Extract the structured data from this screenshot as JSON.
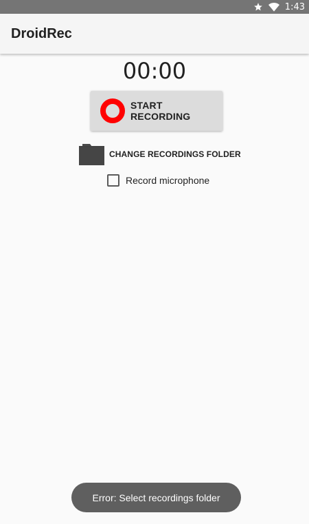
{
  "status_bar": {
    "time": "1:43",
    "icons": [
      "star-icon",
      "wifi-icon"
    ]
  },
  "app_bar": {
    "title": "DroidRec"
  },
  "timer": {
    "value": "00:00"
  },
  "record_button": {
    "label": "START RECORDING",
    "icon": "record-icon",
    "icon_color": "#ff0000"
  },
  "folder_button": {
    "label": "CHANGE RECORDINGS FOLDER",
    "icon": "folder-icon"
  },
  "microphone_option": {
    "label": "Record microphone",
    "checked": false
  },
  "toast": {
    "message": "Error: Select recordings folder"
  },
  "colors": {
    "status_bar": "#757575",
    "app_bar": "#f5f5f5",
    "background": "#fafafa",
    "button": "#dcdcdc",
    "toast": "#5f5f5f"
  }
}
